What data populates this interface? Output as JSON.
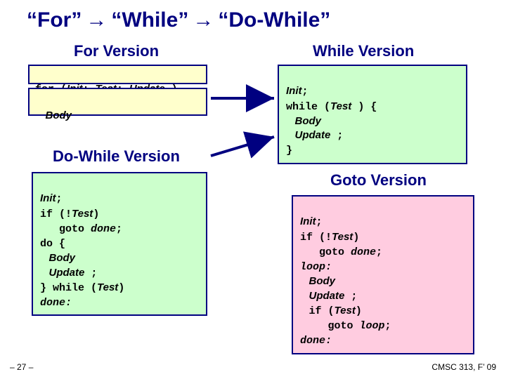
{
  "title": {
    "part1": "“For”",
    "arrow": "→",
    "part2": "“While”",
    "part3": "“Do-While”"
  },
  "sections": {
    "for_version": "For Version",
    "while_version": "While Version",
    "dowhile_version": "Do-While Version",
    "goto_version": "Goto Version"
  },
  "code": {
    "for": {
      "kw_for": "for (",
      "init": "Init",
      "semi1": "; ",
      "test": "Test",
      "semi2": "; ",
      "update": "Update",
      "close": " )",
      "body": "Body"
    },
    "while": {
      "init": "Init",
      "semi": ";",
      "kw_while": "while (",
      "test": "Test",
      "close": " ) {",
      "body": "Body",
      "update": "Update",
      "updsemi": " ;",
      "endbrace": "}"
    },
    "dowhile": {
      "init": "Init",
      "semi": ";",
      "kw_if": "if (!",
      "test1": "Test",
      "close_if": ")",
      "goto_done": "   goto ",
      "done_lbl": "done",
      "semi2": ";",
      "kw_do": "do {",
      "body": "Body",
      "update": "Update",
      "updsemi": " ;",
      "kw_while": "} while (",
      "test2": "Test",
      "close_while": ")",
      "done_label": "done:"
    },
    "goto": {
      "init": "Init",
      "semi": ";",
      "kw_if1": "if (!",
      "test1": "Test",
      "close1": ")",
      "goto_done": "   goto ",
      "done_lbl": "done",
      "semi2": ";",
      "loop_label": "loop:",
      "body": "Body",
      "update": "Update",
      "updsemi": " ;",
      "kw_if2": "if (",
      "test2": "Test",
      "close2": ")",
      "goto_loop": "   goto ",
      "loop_lbl": "loop",
      "semi3": ";",
      "done_label": "done:"
    }
  },
  "footer": {
    "page": "– 27 –",
    "course": "CMSC 313, F’ 09"
  }
}
